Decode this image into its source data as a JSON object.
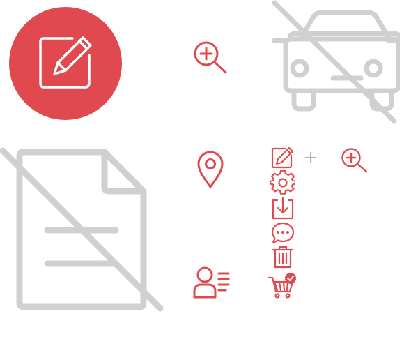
{
  "colors": {
    "accent": "#e04a4e",
    "muted": "#d0d0d0",
    "white": "#ffffff",
    "plus": "#b5b5b5"
  },
  "icons": [
    "edit-icon",
    "zoom-in-icon",
    "no-car-icon",
    "no-document-icon",
    "location-pin-icon",
    "settings-icon",
    "download-icon",
    "chat-icon",
    "trash-icon",
    "user-list-icon",
    "cart-check-icon"
  ],
  "combo": {
    "plus_label": "+"
  }
}
